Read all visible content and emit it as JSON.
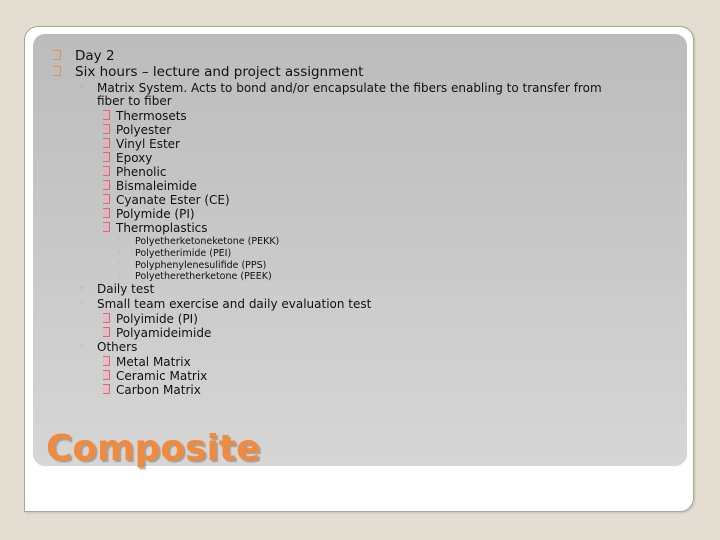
{
  "slide": {
    "title": "Composite",
    "accent_color": "#f08a3e",
    "level1": [
      {
        "text": "Day 2"
      },
      {
        "text": "Six hours – lecture and project assignment"
      }
    ],
    "matrix": {
      "line1": "Matrix System. Acts to bond and/or encapsulate the fibers enabling to transfer from",
      "line2": "fiber to fiber",
      "items": [
        "Thermosets",
        "Polyester",
        "Vinyl Ester",
        "Epoxy",
        "Phenolic",
        "Bismaleimide",
        "Cyanate Ester (CE)",
        "Polymide (PI)",
        "Thermoplastics"
      ],
      "thermoplastics": [
        "Polyetherketoneketone (PEKK)",
        "Polyetherimide (PEI)",
        "Polyphenylenesulifide (PPS)",
        "Polyetheretherketone (PEEK)"
      ]
    },
    "daily_test": "Daily test",
    "small_team": {
      "text": "Small team exercise and daily evaluation test",
      "items": [
        "Polyimide (PI)",
        "Polyamideimide"
      ]
    },
    "others": {
      "text": "Others",
      "items": [
        "Metal Matrix",
        "Ceramic Matrix",
        "Carbon Matrix"
      ]
    }
  }
}
